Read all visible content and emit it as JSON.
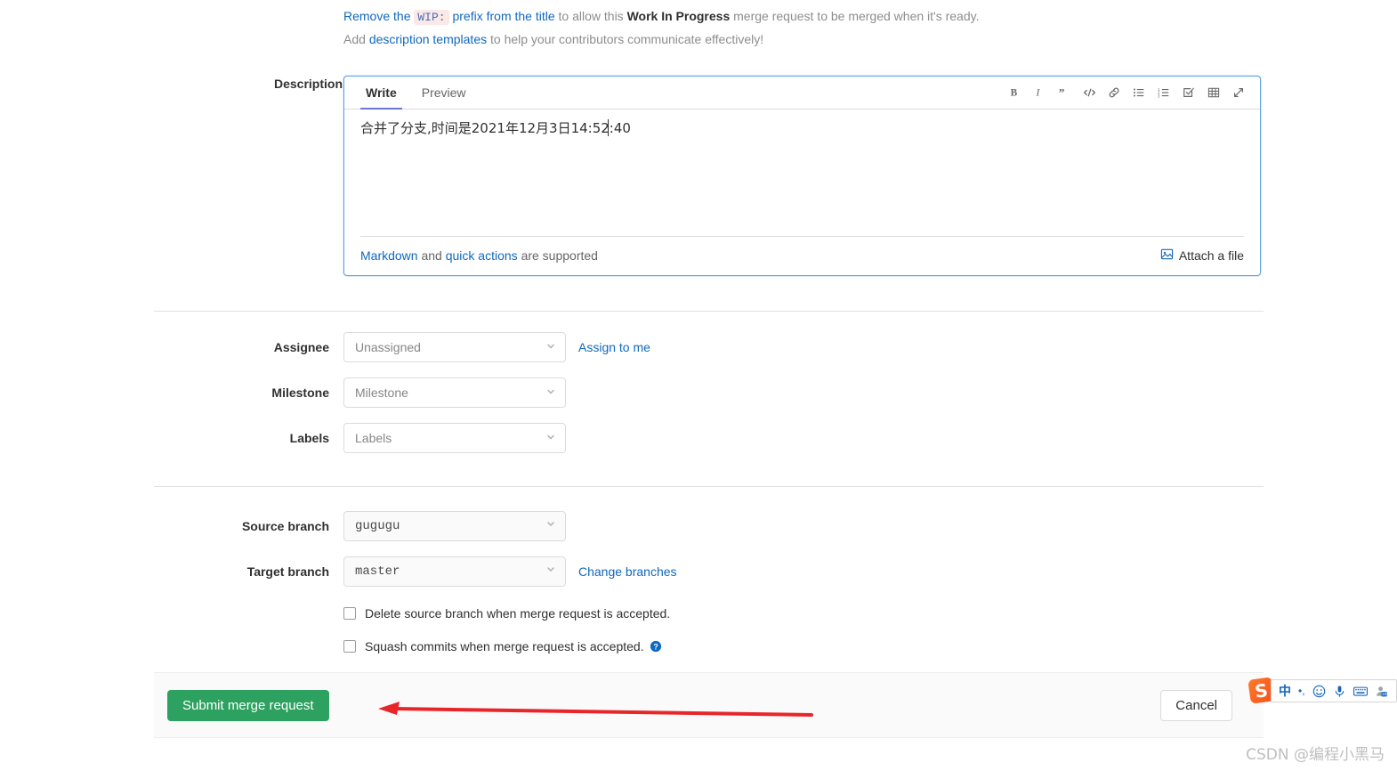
{
  "notices": {
    "wip_line": {
      "link_remove": "Remove the",
      "code": "WIP:",
      "link_prefix": "prefix from the title",
      "mid": "to allow this",
      "strong": "Work In Progress",
      "tail": "merge request to be merged when it's ready."
    },
    "templates_line": {
      "lead": "Add",
      "link": "description templates",
      "tail": "to help your contributors communicate effectively!"
    }
  },
  "description": {
    "label": "Description",
    "tabs": [
      {
        "label": "Write",
        "active": true
      },
      {
        "label": "Preview",
        "active": false
      }
    ],
    "toolbar": [
      {
        "name": "bold-icon",
        "title": "Add bold text"
      },
      {
        "name": "italic-icon",
        "title": "Add italic text"
      },
      {
        "name": "quote-icon",
        "title": "Insert a quote"
      },
      {
        "name": "code-icon",
        "title": "Insert code"
      },
      {
        "name": "link-icon",
        "title": "Add a link"
      },
      {
        "name": "bulleted-list-icon",
        "title": "Add a bullet list"
      },
      {
        "name": "numbered-list-icon",
        "title": "Add a numbered list"
      },
      {
        "name": "task-list-icon",
        "title": "Add a task list"
      },
      {
        "name": "table-icon",
        "title": "Add a table"
      },
      {
        "name": "fullscreen-icon",
        "title": "Go full screen"
      }
    ],
    "value": "合并了分支,时间是2021年12月3日14:52:40",
    "footer": {
      "markdown_link": "Markdown",
      "and_text": "and",
      "quick_actions_link": "quick actions",
      "supported_text": "are supported",
      "attach_label": "Attach a file"
    }
  },
  "meta": {
    "assignee": {
      "label": "Assignee",
      "value": "Unassigned",
      "action": "Assign to me"
    },
    "milestone": {
      "label": "Milestone",
      "value": "Milestone"
    },
    "labels": {
      "label": "Labels",
      "value": "Labels"
    }
  },
  "branches": {
    "source": {
      "label": "Source branch",
      "value": "gugugu"
    },
    "target": {
      "label": "Target branch",
      "value": "master",
      "action": "Change branches"
    },
    "options": {
      "delete_source": {
        "label": "Delete source branch when merge request is accepted.",
        "checked": false
      },
      "squash_commits": {
        "label": "Squash commits when merge request is accepted.",
        "checked": false,
        "help_icon": "help-circle-icon"
      }
    }
  },
  "actions": {
    "submit_label": "Submit merge request",
    "cancel_label": "Cancel",
    "submit_color": "#2da160"
  },
  "annotation": {
    "arrow_color": "#e8262a"
  },
  "ime": {
    "logo": "S",
    "items": [
      "中",
      "′,",
      "☺",
      "⬤",
      "⌨",
      "⛃"
    ]
  },
  "watermark": "CSDN @编程小黑马"
}
